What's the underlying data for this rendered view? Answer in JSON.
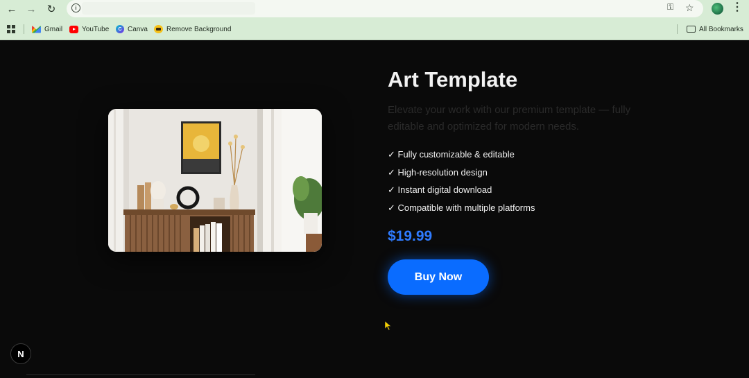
{
  "browser": {
    "nav": {
      "back_icon": "arrow-left-icon",
      "forward_icon": "arrow-right-icon",
      "reload_icon": "reload-icon"
    },
    "address_bar": {
      "site_info_icon": "info-icon",
      "url": ""
    },
    "toolbar_icons": [
      "password-key-icon",
      "star-icon",
      "profile-avatar",
      "more-vert-icon"
    ],
    "bookmarks": [
      {
        "label": "Gmail",
        "icon": "gmail-icon"
      },
      {
        "label": "YouTube",
        "icon": "youtube-icon"
      },
      {
        "label": "Canva",
        "icon": "canva-icon"
      },
      {
        "label": "Remove Background",
        "icon": "remove-bg-icon"
      }
    ],
    "all_bookmarks_label": "All Bookmarks"
  },
  "product": {
    "title": "Art Template",
    "description": "Elevate your work with our premium template — fully editable and optimized for modern needs.",
    "features": [
      "✓ Fully customizable & editable",
      "✓ High-resolution design",
      "✓ Instant digital download",
      "✓ Compatible with multiple platforms"
    ],
    "price": "$19.99",
    "cta_label": "Buy Now",
    "image_subject": "interior-shelf-with-sun-artwork"
  },
  "overlay": {
    "next_badge_label": "N"
  },
  "colors": {
    "accent": "#0a6cff",
    "price": "#2f7bff",
    "page_background": "#0a0a0a",
    "chrome_background": "#d7ecd5"
  }
}
